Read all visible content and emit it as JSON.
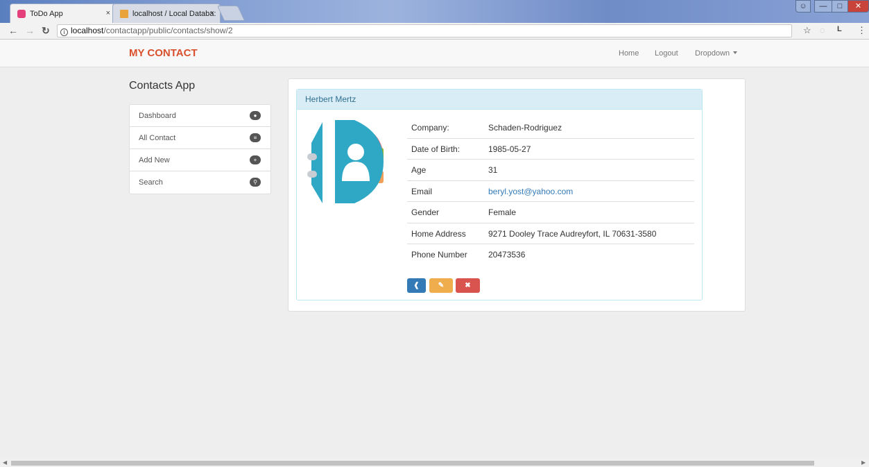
{
  "browser": {
    "tabs": [
      {
        "title": "ToDo App",
        "active": true
      },
      {
        "title": "localhost / Local Databa:",
        "active": false
      }
    ],
    "url_host": "localhost",
    "url_path": "/contactapp/public/contacts/show/2",
    "close_glyph": "×",
    "profile_letter": "L"
  },
  "navbar": {
    "brand": "MY CONTACT",
    "links": [
      "Home",
      "Logout",
      "Dropdown"
    ]
  },
  "sidebar": {
    "title": "Contacts App",
    "items": [
      {
        "label": "Dashboard",
        "icon": "dashboard-icon"
      },
      {
        "label": "All Contact",
        "icon": "list-icon"
      },
      {
        "label": "Add New",
        "icon": "plus-circle-icon"
      },
      {
        "label": "Search",
        "icon": "search-icon"
      }
    ]
  },
  "contact": {
    "name": "Herbert Mertz",
    "fields": [
      {
        "label": "Company:",
        "value": "Schaden-Rodriguez"
      },
      {
        "label": "Date of Birth:",
        "value": "1985-05-27"
      },
      {
        "label": "Age",
        "value": "31"
      },
      {
        "label": "Email",
        "value": "beryl.yost@yahoo.com"
      },
      {
        "label": "Gender",
        "value": "Female"
      },
      {
        "label": "Home Address",
        "value": "9271 Dooley Trace Audreyfort, IL 70631-3580"
      },
      {
        "label": "Phone Number",
        "value": "20473536"
      }
    ]
  },
  "actions": [
    {
      "name": "back-button",
      "icon": "arrow-left-circle-icon",
      "color": "#337ab7"
    },
    {
      "name": "edit-button",
      "icon": "edit-icon",
      "color": "#f0ad4e"
    },
    {
      "name": "delete-button",
      "icon": "close-icon",
      "color": "#d9534f"
    }
  ],
  "colors": {
    "brand": "#d9502d",
    "panel_heading": "#d9edf7",
    "link": "#337ab7"
  }
}
